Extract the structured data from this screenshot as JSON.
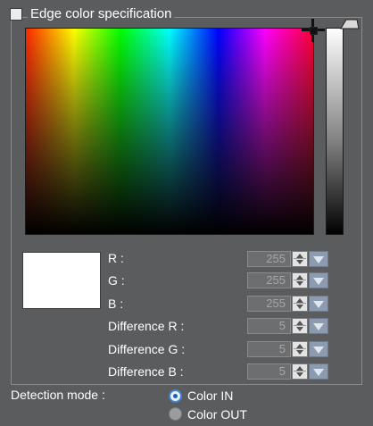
{
  "edge_color_spec": {
    "label": "Edge color specification",
    "checked": false
  },
  "preview_color": "#ffffff",
  "fields": {
    "r": {
      "label": "R :",
      "value": "255"
    },
    "g": {
      "label": "G :",
      "value": "255"
    },
    "b": {
      "label": "B :",
      "value": "255"
    },
    "diff_r": {
      "label": "Difference R :",
      "value": "5"
    },
    "diff_g": {
      "label": "Difference G :",
      "value": "5"
    },
    "diff_b": {
      "label": "Difference B :",
      "value": "5"
    }
  },
  "detection_mode": {
    "label": "Detection mode :",
    "options": [
      "Color IN",
      "Color OUT"
    ],
    "selected": "Color IN"
  },
  "icons": {
    "spin": "up-down-arrows-icon",
    "dropdown": "triangle-down-icon",
    "picker": "crosshair-icon",
    "slider": "slider-handle-icon"
  }
}
